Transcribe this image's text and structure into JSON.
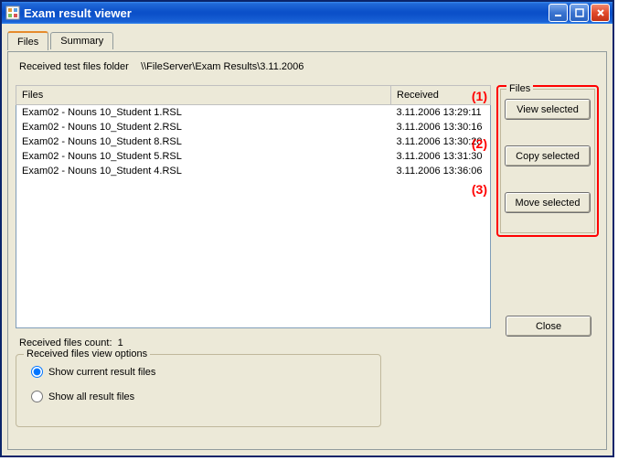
{
  "window": {
    "title": "Exam result viewer"
  },
  "tabs": {
    "files": "Files",
    "summary": "Summary"
  },
  "folder": {
    "label": "Received test files folder",
    "path": "\\\\FileServer\\Exam Results\\3.11.2006"
  },
  "table": {
    "col_files": "Files",
    "col_received": "Received",
    "rows": [
      {
        "file": "Exam02 - Nouns 10_Student 1.RSL",
        "received": "3.11.2006 13:29:11"
      },
      {
        "file": "Exam02 - Nouns 10_Student 2.RSL",
        "received": "3.11.2006 13:30:16"
      },
      {
        "file": "Exam02 - Nouns 10_Student 8.RSL",
        "received": "3.11.2006 13:30:20"
      },
      {
        "file": "Exam02 - Nouns 10_Student 5.RSL",
        "received": "3.11.2006 13:31:30"
      },
      {
        "file": "Exam02 - Nouns 10_Student 4.RSL",
        "received": "3.11.2006 13:36:06"
      }
    ]
  },
  "actions": {
    "group_label": "Files",
    "view": "View selected",
    "copy": "Copy selected",
    "move": "Move selected",
    "close": "Close"
  },
  "annotations": {
    "a1": "(1)",
    "a2": "(2)",
    "a3": "(3)"
  },
  "count": {
    "label": "Received files count:",
    "value": "1"
  },
  "options": {
    "legend": "Received files view options",
    "current": "Show current result files",
    "all": "Show all result files"
  }
}
